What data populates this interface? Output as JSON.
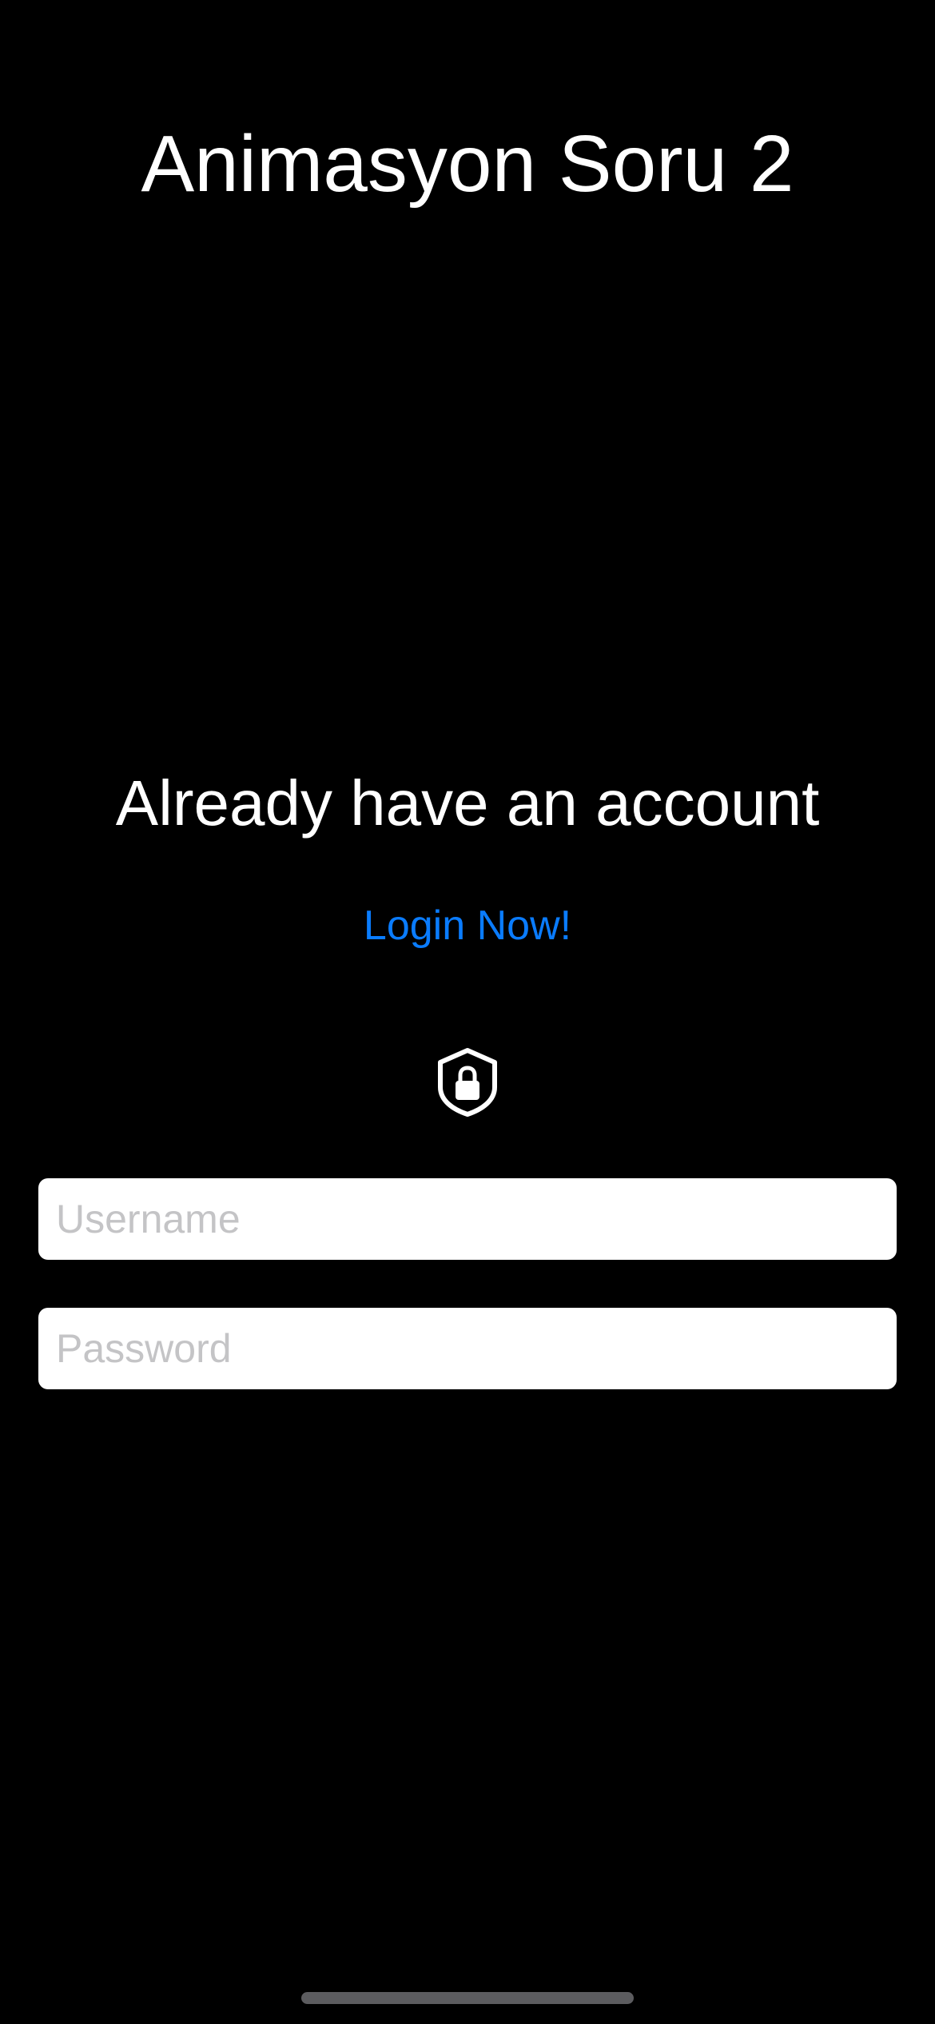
{
  "header": {
    "title": "Animasyon Soru 2"
  },
  "account": {
    "heading": "Already have an account",
    "login_link": "Login Now!"
  },
  "icon": {
    "name": "shield-lock-icon"
  },
  "form": {
    "username_placeholder": "Username",
    "username_value": "",
    "password_placeholder": "Password",
    "password_value": ""
  },
  "colors": {
    "background": "#000000",
    "text": "#ffffff",
    "link": "#0a7cff",
    "field_background": "#ffffff",
    "placeholder": "#c4c4c6"
  }
}
